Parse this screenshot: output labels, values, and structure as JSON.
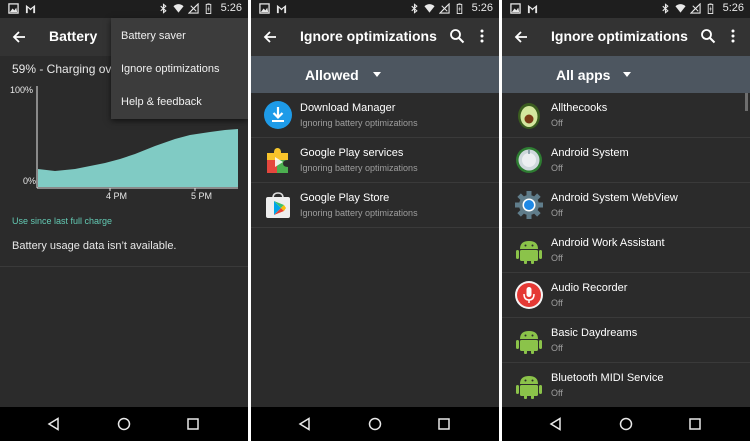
{
  "status_bar": {
    "time": "5:26"
  },
  "panel1": {
    "title": "Battery",
    "charging_text": "59% - Charging ove",
    "menu": [
      "Battery saver",
      "Ignore optimizations",
      "Help & feedback"
    ],
    "graph": {
      "ylabel_top": "100%",
      "ylabel_bottom": "0%",
      "xticks": [
        "4 PM",
        "5 PM"
      ],
      "fill_color": "#80cbc4"
    },
    "use_since": "Use since last full charge",
    "no_data": "Battery usage data isn’t available."
  },
  "panel2": {
    "title": "Ignore optimizations",
    "filter": "Allowed",
    "apps": [
      {
        "name": "Download Manager",
        "sub": "Ignoring battery optimizations",
        "icon": "download-icon"
      },
      {
        "name": "Google Play services",
        "sub": "Ignoring battery optimizations",
        "icon": "puzzle-icon"
      },
      {
        "name": "Google Play Store",
        "sub": "Ignoring battery optimizations",
        "icon": "play-store-icon"
      }
    ]
  },
  "panel3": {
    "title": "Ignore optimizations",
    "filter": "All apps",
    "apps": [
      {
        "name": "Allthecooks",
        "sub": "Off",
        "icon": "avocado-icon"
      },
      {
        "name": "Android System",
        "sub": "Off",
        "icon": "android-system-icon"
      },
      {
        "name": "Android System WebView",
        "sub": "Off",
        "icon": "gear-icon"
      },
      {
        "name": "Android Work Assistant",
        "sub": "Off",
        "icon": "android-icon"
      },
      {
        "name": "Audio Recorder",
        "sub": "Off",
        "icon": "microphone-icon"
      },
      {
        "name": "Basic Daydreams",
        "sub": "Off",
        "icon": "android-icon"
      },
      {
        "name": "Bluetooth MIDI Service",
        "sub": "Off",
        "icon": "android-icon"
      }
    ]
  },
  "colors": {
    "accent": "#63c9b3",
    "filter_bar": "#4d5660",
    "background": "#2b2b2b"
  }
}
